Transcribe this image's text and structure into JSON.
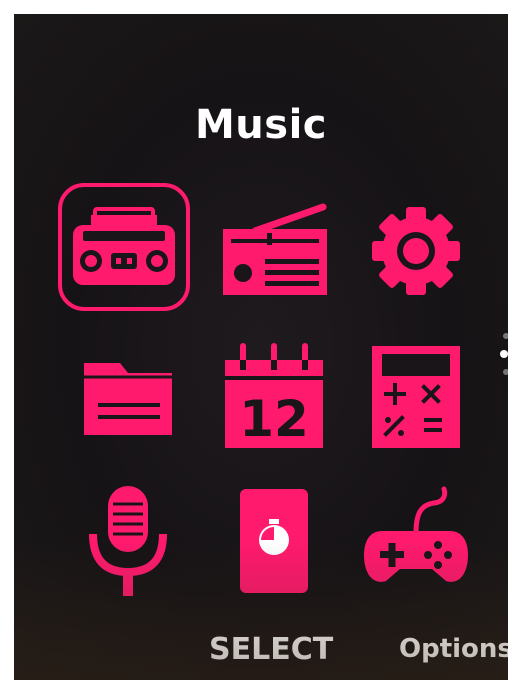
{
  "screen": {
    "title": "Music"
  },
  "apps": [
    {
      "name": "Music",
      "icon": "boombox-icon",
      "selected": true
    },
    {
      "name": "Radio",
      "icon": "radio-icon",
      "selected": false
    },
    {
      "name": "Settings",
      "icon": "gear-icon",
      "selected": false
    },
    {
      "name": "Files",
      "icon": "folder-icon",
      "selected": false
    },
    {
      "name": "Calendar",
      "icon": "calendar-icon",
      "selected": false,
      "calendar_day": "12"
    },
    {
      "name": "Calculator",
      "icon": "calculator-icon",
      "selected": false
    },
    {
      "name": "Recorder",
      "icon": "microphone-icon",
      "selected": false
    },
    {
      "name": "Clock",
      "icon": "stopwatch-icon",
      "selected": false
    },
    {
      "name": "Games",
      "icon": "gamepad-icon",
      "selected": false
    }
  ],
  "softkeys": {
    "center": "SELECT",
    "right": "Options"
  },
  "colors": {
    "accent": "#ff1a6e",
    "background": "#171417",
    "text": "#ffffff"
  }
}
